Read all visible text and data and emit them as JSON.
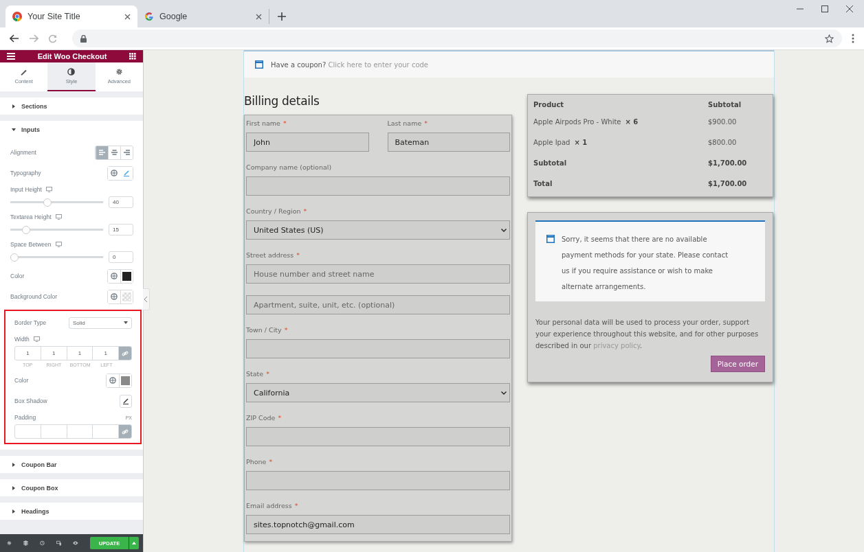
{
  "browser": {
    "tabs": [
      {
        "title": "Your Site Title",
        "selected": true
      },
      {
        "title": "Google",
        "selected": false
      }
    ]
  },
  "editor": {
    "title": "Edit Woo Checkout",
    "panel_tabs": [
      {
        "label": "Content",
        "selected": false
      },
      {
        "label": "Style",
        "selected": true
      },
      {
        "label": "Advanced",
        "selected": false
      }
    ],
    "sections_before": [
      {
        "label": "Sections",
        "expanded": false
      }
    ],
    "open_section": {
      "label": "Inputs",
      "expanded": true
    },
    "controls": [
      {
        "kind": "alignment",
        "label": "Alignment",
        "options": [
          {
            "selected": true
          },
          {
            "selected": false
          },
          {
            "selected": false
          }
        ]
      },
      {
        "kind": "typography",
        "label": "Typography"
      },
      {
        "kind": "slider",
        "label": "Input Height",
        "responsive": true,
        "level": 0.39,
        "value": "40"
      },
      {
        "kind": "slider",
        "label": "Textarea Height",
        "responsive": true,
        "level": 0.14,
        "value": "15"
      },
      {
        "kind": "slider",
        "label": "Space Between",
        "responsive": true,
        "level": 0,
        "value": "0"
      },
      {
        "kind": "color",
        "label": "Color",
        "color": "#222222"
      },
      {
        "kind": "color_unset",
        "label": "Background Color"
      }
    ],
    "highlighted_controls": [
      {
        "kind": "select",
        "label": "Border Type",
        "value": "Solid"
      },
      {
        "kind": "dimensions",
        "label": "Width",
        "responsive": true,
        "values": [
          "1",
          "1",
          "1",
          "1"
        ],
        "sublabels": [
          "TOP",
          "RIGHT",
          "BOTTOM",
          "LEFT"
        ]
      },
      {
        "kind": "color",
        "label": "Color",
        "color": "#8a8a8a"
      },
      {
        "kind": "shadow",
        "label": "Box Shadow"
      },
      {
        "kind": "dimensions",
        "label": "Padding",
        "unit": "PX"
      }
    ],
    "sections_after": [
      {
        "label": "Coupon Bar",
        "expanded": false
      },
      {
        "label": "Coupon Box",
        "expanded": false
      },
      {
        "label": "Headings",
        "expanded": false
      }
    ],
    "update_button": "UPDATE"
  },
  "coupon": {
    "text": "Have a coupon?",
    "link": "Click here to enter your code"
  },
  "billing": {
    "heading": "Billing details",
    "rows": [
      {
        "fields": [
          {
            "label": "First name",
            "required_mark": "*",
            "kind": "input",
            "value": "John"
          },
          {
            "label": "Last name",
            "required_mark": "*",
            "kind": "input",
            "value": "Bateman"
          }
        ]
      },
      {
        "fields": [
          {
            "label": "Company name (optional)",
            "kind": "input"
          }
        ]
      },
      {
        "fields": [
          {
            "label": "Country / Region",
            "required_mark": "*",
            "kind": "select",
            "value": "United States (US)"
          }
        ]
      },
      {
        "fields": [
          {
            "label": "Street address",
            "required_mark": "*",
            "kind": "input",
            "placeholder": "House number and street name"
          }
        ]
      },
      {
        "fields": [
          {
            "kind": "input",
            "placeholder": "Apartment, suite, unit, etc. (optional)"
          }
        ]
      },
      {
        "fields": [
          {
            "label": "Town / City",
            "required_mark": "*",
            "kind": "input"
          }
        ]
      },
      {
        "fields": [
          {
            "label": "State",
            "required_mark": "*",
            "kind": "select",
            "value": "California"
          }
        ]
      },
      {
        "fields": [
          {
            "label": "ZIP Code",
            "required_mark": "*",
            "kind": "input"
          }
        ]
      },
      {
        "fields": [
          {
            "label": "Phone",
            "required_mark": "*",
            "kind": "input"
          }
        ]
      },
      {
        "fields": [
          {
            "label": "Email address",
            "required_mark": "*",
            "kind": "input",
            "value": "sites.topnotch@gmail.com"
          }
        ]
      }
    ]
  },
  "order": {
    "columns": [
      "Product",
      "Subtotal"
    ],
    "rows": [
      {
        "kind": "item",
        "product": "Apple Airpods Pro - White",
        "qty": "× 6",
        "amount": "$900.00"
      },
      {
        "kind": "item",
        "product": "Apple Ipad",
        "qty": "× 1",
        "amount": "$800.00"
      },
      {
        "kind": "total",
        "product": "Subtotal",
        "amount": "$1,700.00"
      },
      {
        "kind": "total",
        "product": "Total",
        "amount": "$1,700.00"
      }
    ]
  },
  "payment": {
    "notice": "Sorry, it seems that there are no available payment methods for your state. Please contact us if you require assistance or wish to make alternate arrangements.",
    "privacy_before": "Your personal data will be used to process your order, support your experience throughout this website, and for other purposes described in our ",
    "privacy_link": "privacy policy",
    "privacy_after": ".",
    "button": "Place order"
  }
}
